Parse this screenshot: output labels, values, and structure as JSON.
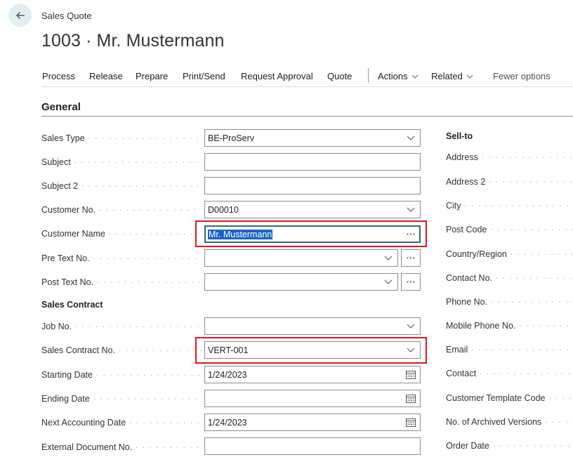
{
  "header": {
    "caption": "Sales Quote",
    "title": "1003 · Mr. Mustermann"
  },
  "actions": {
    "process": "Process",
    "release": "Release",
    "prepare": "Prepare",
    "print_send": "Print/Send",
    "request_approval": "Request Approval",
    "quote": "Quote",
    "actions_menu": "Actions",
    "related": "Related",
    "fewer_options": "Fewer options"
  },
  "general": {
    "title": "General",
    "sales_type": {
      "label": "Sales Type",
      "value": "BE-ProServ"
    },
    "subject": {
      "label": "Subject",
      "value": ""
    },
    "subject2": {
      "label": "Subject 2",
      "value": ""
    },
    "customer_no": {
      "label": "Customer No.",
      "value": "D00010"
    },
    "customer_name": {
      "label": "Customer Name",
      "value": "Mr. Mustermann"
    },
    "pre_text_no": {
      "label": "Pre Text No.",
      "value": ""
    },
    "post_text_no": {
      "label": "Post Text No.",
      "value": ""
    },
    "sales_contract_heading": "Sales Contract",
    "job_no": {
      "label": "Job No.",
      "value": ""
    },
    "sales_contract_no": {
      "label": "Sales Contract No.",
      "value": "VERT-001"
    },
    "starting_date": {
      "label": "Starting Date",
      "value": "1/24/2023"
    },
    "ending_date": {
      "label": "Ending Date",
      "value": ""
    },
    "next_accounting_date": {
      "label": "Next Accounting Date",
      "value": "1/24/2023"
    },
    "external_document_no": {
      "label": "External Document No.",
      "value": ""
    }
  },
  "sell_to": {
    "heading": "Sell-to",
    "labels": [
      "Address",
      "Address 2",
      "City",
      "Post Code",
      "Country/Region",
      "Contact No.",
      "Phone No.",
      "Mobile Phone No.",
      "Email",
      "Contact",
      "Customer Template Code",
      "No. of Archived Versions",
      "Order Date"
    ]
  },
  "colors": {
    "highlight": "#e0161d",
    "focus": "#2e6e6b",
    "selection": "#1b63c7",
    "back_button_bg": "#e3eef3"
  },
  "icons": {
    "back": "arrow-left-icon",
    "dropdown": "chevron-down-icon",
    "lookup": "ellipsis-icon",
    "date": "calendar-icon"
  }
}
